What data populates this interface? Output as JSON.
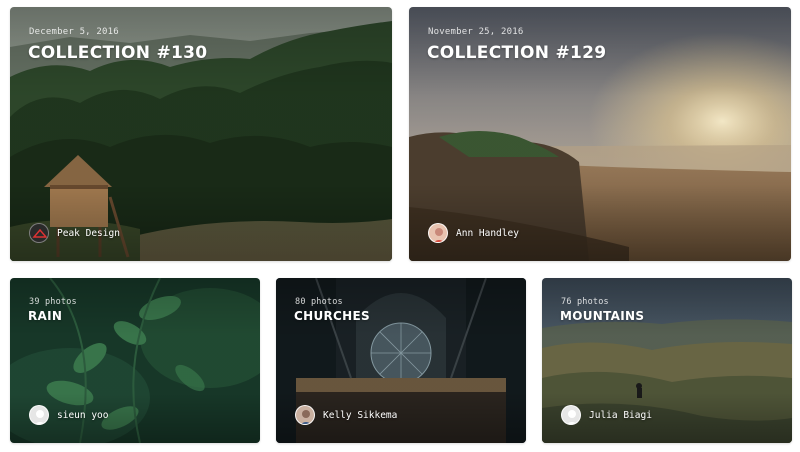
{
  "featured": [
    {
      "date": "December 5, 2016",
      "title": "COLLECTION #130",
      "author": "Peak Design",
      "avatar_icon": "peak-design-logo-icon"
    },
    {
      "date": "November 25, 2016",
      "title": "COLLECTION #129",
      "author": "Ann Handley",
      "avatar_icon": "user-avatar-icon"
    }
  ],
  "collections": [
    {
      "count": "39 photos",
      "title": "RAIN",
      "author": "sieun yoo",
      "avatar_icon": "default-avatar-icon"
    },
    {
      "count": "80 photos",
      "title": "CHURCHES",
      "author": "Kelly Sikkema",
      "avatar_icon": "user-avatar-icon"
    },
    {
      "count": "76 photos",
      "title": "MOUNTAINS",
      "author": "Julia Biagi",
      "avatar_icon": "default-avatar-icon"
    }
  ]
}
